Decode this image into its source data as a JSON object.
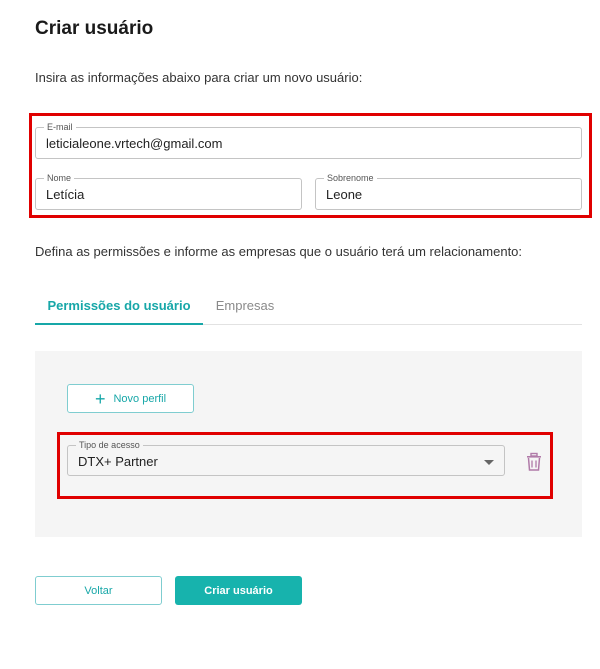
{
  "page": {
    "title": "Criar usuário",
    "intro": "Insira as informações abaixo para criar um novo usuário:",
    "description": "Defina as permissões e informe as empresas que o usuário terá um relacionamento:"
  },
  "form": {
    "email": {
      "label": "E-mail",
      "value": "leticialeone.vrtech@gmail.com"
    },
    "first_name": {
      "label": "Nome",
      "value": "Letícia"
    },
    "last_name": {
      "label": "Sobrenome",
      "value": "Leone"
    }
  },
  "tabs": [
    {
      "label": "Permissões do usuário",
      "active": true
    },
    {
      "label": "Empresas",
      "active": false
    }
  ],
  "permissions": {
    "new_profile_label": "Novo perfil",
    "access_type": {
      "label": "Tipo de acesso",
      "value": "DTX+ Partner"
    },
    "icons": {
      "add": "plus-icon",
      "dropdown": "caret-down-icon",
      "delete": "trash-icon"
    }
  },
  "actions": {
    "back_label": "Voltar",
    "create_label": "Criar usuário"
  },
  "colors": {
    "accent": "#17a7a8",
    "primary_button": "#17b3ad",
    "highlight": "#e00000",
    "delete_icon": "#b07aa8"
  }
}
